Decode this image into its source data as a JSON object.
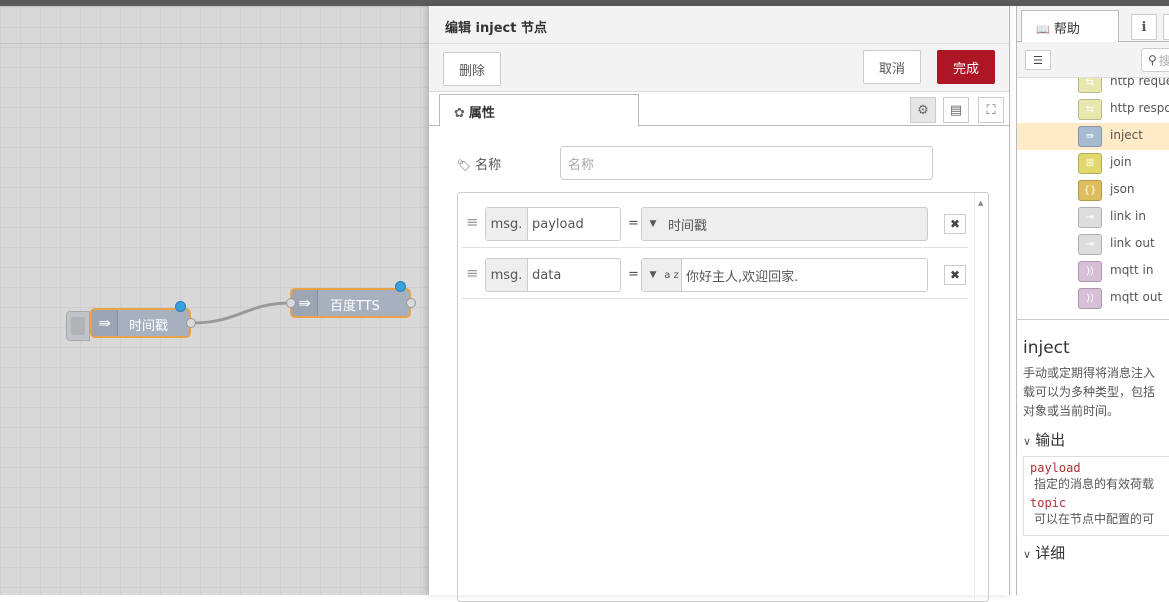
{
  "workspace": {
    "nodes": [
      {
        "label": "时间戳",
        "color": "#a6b0bf"
      },
      {
        "label": "百度TTS",
        "color": "#a6b0bf"
      }
    ]
  },
  "editor": {
    "title": "编辑 inject 节点",
    "delete_label": "删除",
    "cancel_label": "取消",
    "done_label": "完成",
    "tab_label": "属性",
    "name_label": "名称",
    "name_placeholder": "名称",
    "props": [
      {
        "prefix": "msg.",
        "key": "payload",
        "eq": "=",
        "value": "时间戳"
      },
      {
        "prefix": "msg.",
        "key": "data",
        "eq": "=",
        "type_icon": "a z",
        "value": "你好主人,欢迎回家."
      }
    ]
  },
  "sidebar": {
    "tab_label": "帮助",
    "info_label": "i",
    "search_placeholder": "搜",
    "palette": [
      {
        "label": "http reque",
        "color": "#e7e7ae"
      },
      {
        "label": "http respo",
        "color": "#e7e7ae"
      },
      {
        "label": "inject",
        "color": "#a6bbcf",
        "selected": true
      },
      {
        "label": "join",
        "color": "#e2d96e"
      },
      {
        "label": "json",
        "color": "#debd5c"
      },
      {
        "label": "link in",
        "color": "#dddddd"
      },
      {
        "label": "link out",
        "color": "#dddddd"
      },
      {
        "label": "mqtt in",
        "color": "#d8bfd8"
      },
      {
        "label": "mqtt out",
        "color": "#d8bfd8"
      }
    ],
    "help": {
      "title": "inject",
      "desc_lines": [
        "手动或定期得将消息注入",
        "载可以为多种类型，包括",
        "对象或当前时间。"
      ],
      "output_heading": "输出",
      "outputs": [
        {
          "name": "payload",
          "desc": "指定的消息的有效荷载"
        },
        {
          "name": "topic",
          "desc": "可以在节点中配置的可"
        }
      ],
      "details_heading": "详细"
    }
  }
}
